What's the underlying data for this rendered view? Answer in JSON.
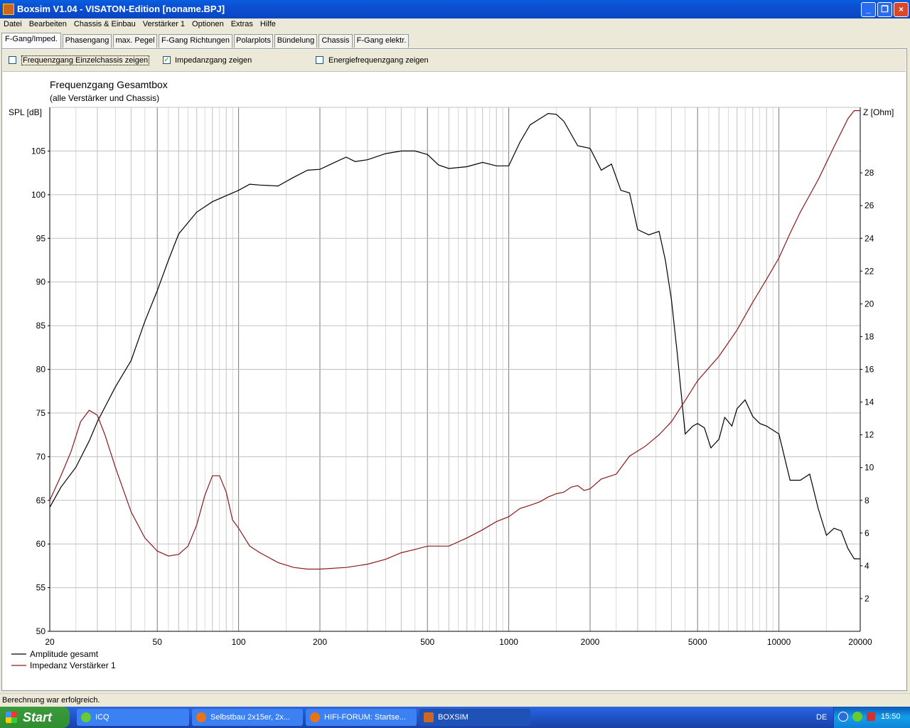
{
  "window": {
    "title": "Boxsim V1.04 - VISATON-Edition [noname.BPJ]",
    "min_glyph": "_",
    "max_glyph": "❐",
    "close_glyph": "×"
  },
  "menu": [
    "Datei",
    "Bearbeiten",
    "Chassis & Einbau",
    "Verstärker 1",
    "Optionen",
    "Extras",
    "Hilfe"
  ],
  "tabs": [
    "F-Gang/Imped.",
    "Phasengang",
    "max. Pegel",
    "F-Gang Richtungen",
    "Polarplots",
    "Bündelung",
    "Chassis",
    "F-Gang elektr."
  ],
  "options": [
    {
      "label": "Frequenzgang Einzelchassis zeigen",
      "checked": false
    },
    {
      "label": "Impedanzgang zeigen",
      "checked": true
    },
    {
      "label": "Energiefrequenzgang zeigen",
      "checked": false
    }
  ],
  "status": "Berechnung war erfolgreich.",
  "taskbar": {
    "start": "Start",
    "items": [
      "ICQ",
      "Selbstbau 2x15er, 2x...",
      "HIFI-FORUM: Startse...",
      "BOXSIM"
    ],
    "lang": "DE",
    "clock": "15:50"
  },
  "colors": {
    "amplitude": "#000000",
    "impedance": "#8b1a1a",
    "grid": "#c0c0c0",
    "grid_major": "#7a7a7a"
  },
  "chart_data": {
    "type": "line",
    "title": "Frequenzgang Gesamtbox",
    "subtitle": "(alle Verstärker und Chassis)",
    "xlabel": "",
    "ylabel": "SPL [dB]",
    "y2label": "Z [Ohm]",
    "xscale": "log",
    "xlim": [
      20,
      20000
    ],
    "ylim": [
      50,
      110
    ],
    "y2lim": [
      0,
      32
    ],
    "xticks": [
      20,
      50,
      100,
      200,
      500,
      1000,
      2000,
      5000,
      10000,
      20000
    ],
    "yticks": [
      50,
      55,
      60,
      65,
      70,
      75,
      80,
      85,
      90,
      95,
      100,
      105
    ],
    "y2ticks": [
      2,
      4,
      6,
      8,
      10,
      12,
      14,
      16,
      18,
      20,
      22,
      24,
      26,
      28
    ],
    "grid": true,
    "legend_position": "bottom-left",
    "series": [
      {
        "name": "Amplitude gesamt",
        "axis": "left",
        "x": [
          20,
          22,
          25,
          28,
          30,
          35,
          40,
          45,
          50,
          55,
          60,
          70,
          80,
          100,
          110,
          120,
          140,
          160,
          180,
          200,
          220,
          250,
          270,
          300,
          350,
          400,
          450,
          500,
          550,
          600,
          700,
          800,
          900,
          1000,
          1100,
          1200,
          1400,
          1500,
          1600,
          1800,
          2000,
          2200,
          2400,
          2600,
          2800,
          3000,
          3300,
          3600,
          3800,
          4000,
          4200,
          4500,
          4800,
          5000,
          5300,
          5600,
          6000,
          6300,
          6700,
          7000,
          7500,
          8000,
          8500,
          9000,
          10000,
          11000,
          12000,
          13000,
          14000,
          15000,
          16000,
          17000,
          18000,
          19000,
          20000
        ],
        "y": [
          64.2,
          66.5,
          68.8,
          71.8,
          74,
          78,
          81,
          85.5,
          89,
          92.5,
          95.5,
          98,
          99.2,
          100.5,
          101.2,
          101.1,
          101,
          102,
          102.8,
          102.9,
          103.5,
          104.3,
          103.8,
          104,
          104.7,
          105,
          105,
          104.6,
          103.4,
          103,
          103.2,
          103.7,
          103.3,
          103.3,
          106,
          108,
          109.3,
          109.2,
          108.4,
          105.6,
          105.3,
          102.8,
          103.5,
          100.5,
          100.2,
          96,
          95.4,
          95.8,
          92.5,
          88,
          82,
          72.6,
          73.5,
          73.8,
          73.3,
          71,
          72,
          74.5,
          73.5,
          75.5,
          76.5,
          74.6,
          73.8,
          73.5,
          72.6,
          67.3,
          67.3,
          68,
          64,
          61,
          61.8,
          61.5,
          59.5,
          58.3,
          58.3
        ]
      },
      {
        "name": "Impedanz Verstärker 1",
        "axis": "right",
        "x": [
          20,
          22,
          24,
          26,
          28,
          30,
          32,
          35,
          40,
          45,
          50,
          55,
          60,
          65,
          70,
          75,
          80,
          85,
          90,
          95,
          100,
          110,
          120,
          140,
          160,
          180,
          200,
          250,
          300,
          350,
          400,
          450,
          500,
          600,
          700,
          800,
          900,
          1000,
          1100,
          1200,
          1300,
          1400,
          1500,
          1600,
          1700,
          1800,
          1900,
          2000,
          2200,
          2500,
          2800,
          3200,
          3600,
          4000,
          4500,
          5000,
          6000,
          7000,
          8000,
          9000,
          10000,
          11000,
          12000,
          14000,
          16000,
          18000,
          19000,
          20000
        ],
        "y": [
          8,
          9.5,
          11,
          12.8,
          13.5,
          13.2,
          12,
          10,
          7.3,
          5.7,
          4.9,
          4.6,
          4.7,
          5.2,
          6.5,
          8.3,
          9.5,
          9.5,
          8.5,
          6.8,
          6.3,
          5.2,
          4.8,
          4.2,
          3.9,
          3.8,
          3.8,
          3.9,
          4.1,
          4.4,
          4.8,
          5,
          5.2,
          5.2,
          5.7,
          6.2,
          6.7,
          7,
          7.5,
          7.7,
          7.9,
          8.2,
          8.4,
          8.5,
          8.8,
          8.9,
          8.6,
          8.7,
          9.3,
          9.6,
          10.7,
          11.3,
          12,
          12.8,
          14.1,
          15.3,
          16.8,
          18.4,
          20.1,
          21.5,
          22.8,
          24.3,
          25.6,
          27.6,
          29.6,
          31.3,
          31.8,
          31.8
        ]
      }
    ]
  }
}
